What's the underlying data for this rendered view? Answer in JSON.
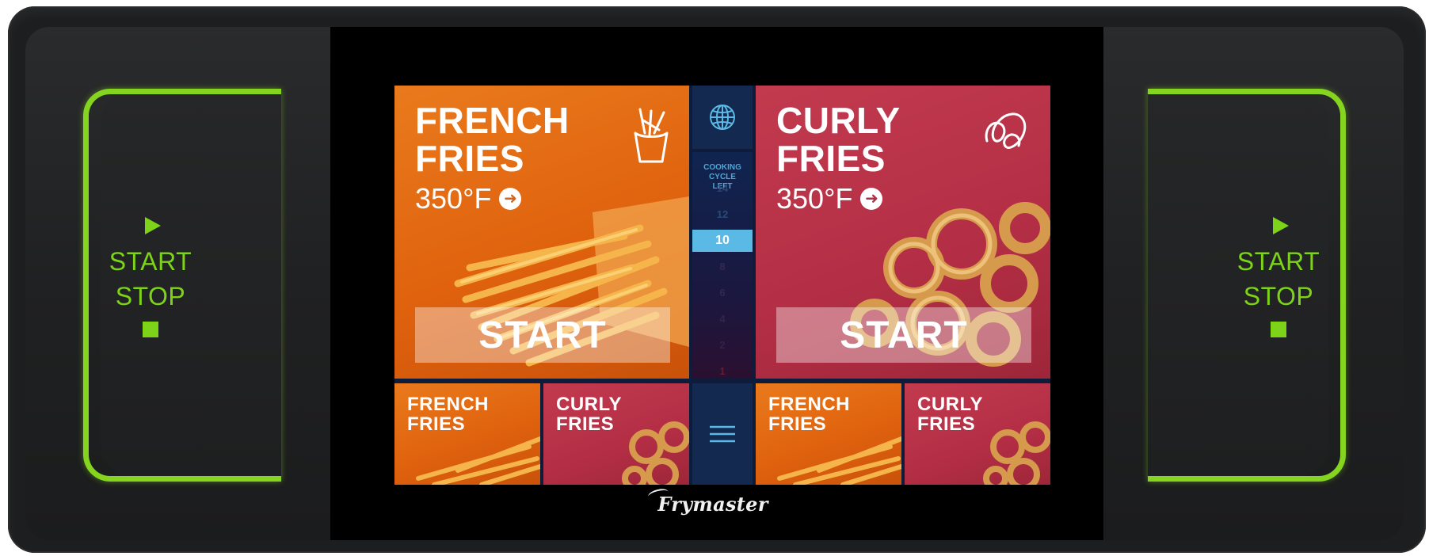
{
  "brand": "Frymaster",
  "side_buttons": {
    "left": {
      "line1": "START",
      "line2": "STOP"
    },
    "right": {
      "line1": "START",
      "line2": "STOP"
    }
  },
  "products": [
    {
      "name": "FRENCH FRIES",
      "temperature": "350°F",
      "start_label": "START",
      "color": "#e0620e",
      "icon": "fries-cup-icon"
    },
    {
      "name": "CURLY FRIES",
      "temperature": "350°F",
      "start_label": "START",
      "color": "#b32e45",
      "icon": "curly-swirl-icon"
    }
  ],
  "small_tiles": [
    {
      "name": "FRENCH FRIES"
    },
    {
      "name": "CURLY FRIES"
    },
    {
      "name": "FRENCH FRIES"
    },
    {
      "name": "CURLY FRIES"
    }
  ],
  "cooking_cycle": {
    "title": "COOKING CYCLE LEFT",
    "values": [
      "14",
      "12",
      "10",
      "8",
      "6",
      "4",
      "2",
      "1"
    ],
    "active": "10"
  },
  "icons": {
    "globe": "globe-icon",
    "menu": "menu-icon"
  },
  "colors": {
    "accent_green": "#7cd318",
    "orange": "#e0620e",
    "red": "#b32e45",
    "cycle_active": "#5bb9e6"
  }
}
